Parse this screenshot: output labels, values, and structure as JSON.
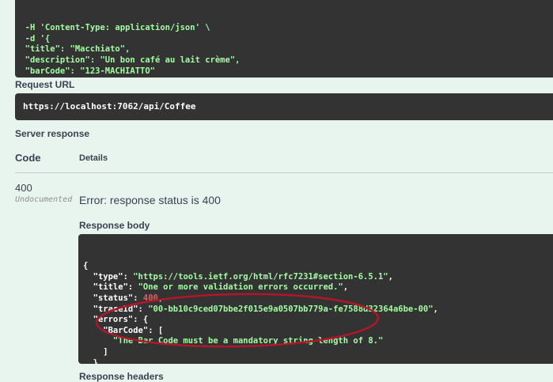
{
  "curl": {
    "lines": [
      "  -H 'Content-Type: application/json' \\",
      "  -d '{",
      "  \"title\": \"Macchiato\",",
      "  \"description\": \"Un bon café au lait crème\",",
      "  \"barCode\": \"123-MACHIATTO\"",
      "}'"
    ]
  },
  "request_url": {
    "label": "Request URL",
    "value": "https://localhost:7062/api/Coffee"
  },
  "server_response": {
    "label": "Server response",
    "col_code": "Code",
    "col_details": "Details",
    "code": "400",
    "undocumented": "Undocumented",
    "error": "Error: response status is 400"
  },
  "response_body": {
    "label": "Response body",
    "lines": [
      {
        "k": "{"
      },
      {
        "k": "  \"type\"",
        "v": "\"https://tools.ietf.org/html/rfc7231#section-6.5.1\"",
        "e": ","
      },
      {
        "k": "  \"title\"",
        "v": "\"One or more validation errors occurred.\"",
        "e": ","
      },
      {
        "k": "  \"status\"",
        "n": "400",
        "e": ","
      },
      {
        "k": "  \"traceId\"",
        "v": "\"00-bb10c9ced07bbe2f015e9a0507bb779a-fe7588d32364a6be-00\"",
        "e": ","
      },
      {
        "k": "  \"errors\"",
        "e": ": {"
      },
      {
        "k": "    \"BarCode\"",
        "e": ": ["
      },
      {
        "v": "      \"The Bar Code must be a mandatory string length of 8.\""
      },
      {
        "k": "    ]"
      },
      {
        "k": "  }"
      },
      {
        "k": "}"
      }
    ]
  },
  "response_headers": {
    "label": "Response headers"
  },
  "annotation_color": "#b0182a"
}
